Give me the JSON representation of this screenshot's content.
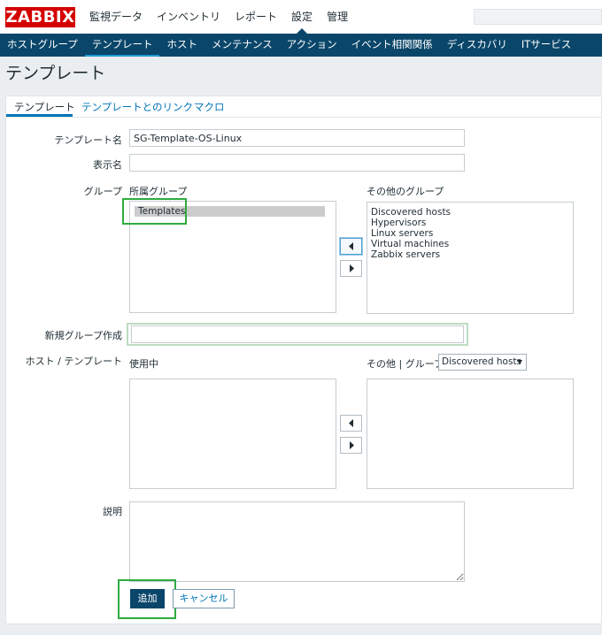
{
  "header": {
    "logo": "ZABBIX",
    "menu": [
      {
        "label": "監視データ"
      },
      {
        "label": "インベントリ"
      },
      {
        "label": "レポート"
      },
      {
        "label": "設定"
      },
      {
        "label": "管理"
      }
    ],
    "active_menu": "設定"
  },
  "subnav": {
    "items": [
      {
        "label": "ホストグループ"
      },
      {
        "label": "テンプレート"
      },
      {
        "label": "ホスト"
      },
      {
        "label": "メンテナンス"
      },
      {
        "label": "アクション"
      },
      {
        "label": "イベント相関関係"
      },
      {
        "label": "ディスカバリ"
      },
      {
        "label": "ITサービス"
      }
    ],
    "active": "テンプレート"
  },
  "page": {
    "title": "テンプレート"
  },
  "tabs": [
    {
      "label": "テンプレート"
    },
    {
      "label": "テンプレートとのリンク"
    },
    {
      "label": "マクロ"
    }
  ],
  "form": {
    "template_name_label": "テンプレート名",
    "template_name_value": "SG-Template-OS-Linux",
    "display_name_label": "表示名",
    "display_name_value": "",
    "groups_label": "グループ",
    "in_groups_label": "所属グループ",
    "other_groups_label": "その他のグループ",
    "in_groups": [
      "Templates"
    ],
    "other_groups": [
      "Discovered hosts",
      "Hypervisors",
      "Linux servers",
      "Virtual machines",
      "Zabbix servers"
    ],
    "new_group_label": "新規グループ作成",
    "new_group_value": "",
    "hosts_label": "ホスト / テンプレート",
    "in_use_label": "使用中",
    "other_group_label": "その他 | グループ",
    "group_select_value": "Discovered hosts",
    "description_label": "説明",
    "description_value": "",
    "add_button": "追加",
    "cancel_button": "キャンセル"
  },
  "colors": {
    "brand_red": "#d40000",
    "nav_blue": "#0a466a",
    "link_blue": "#0275b8",
    "highlight_green": "#2eab3f"
  }
}
